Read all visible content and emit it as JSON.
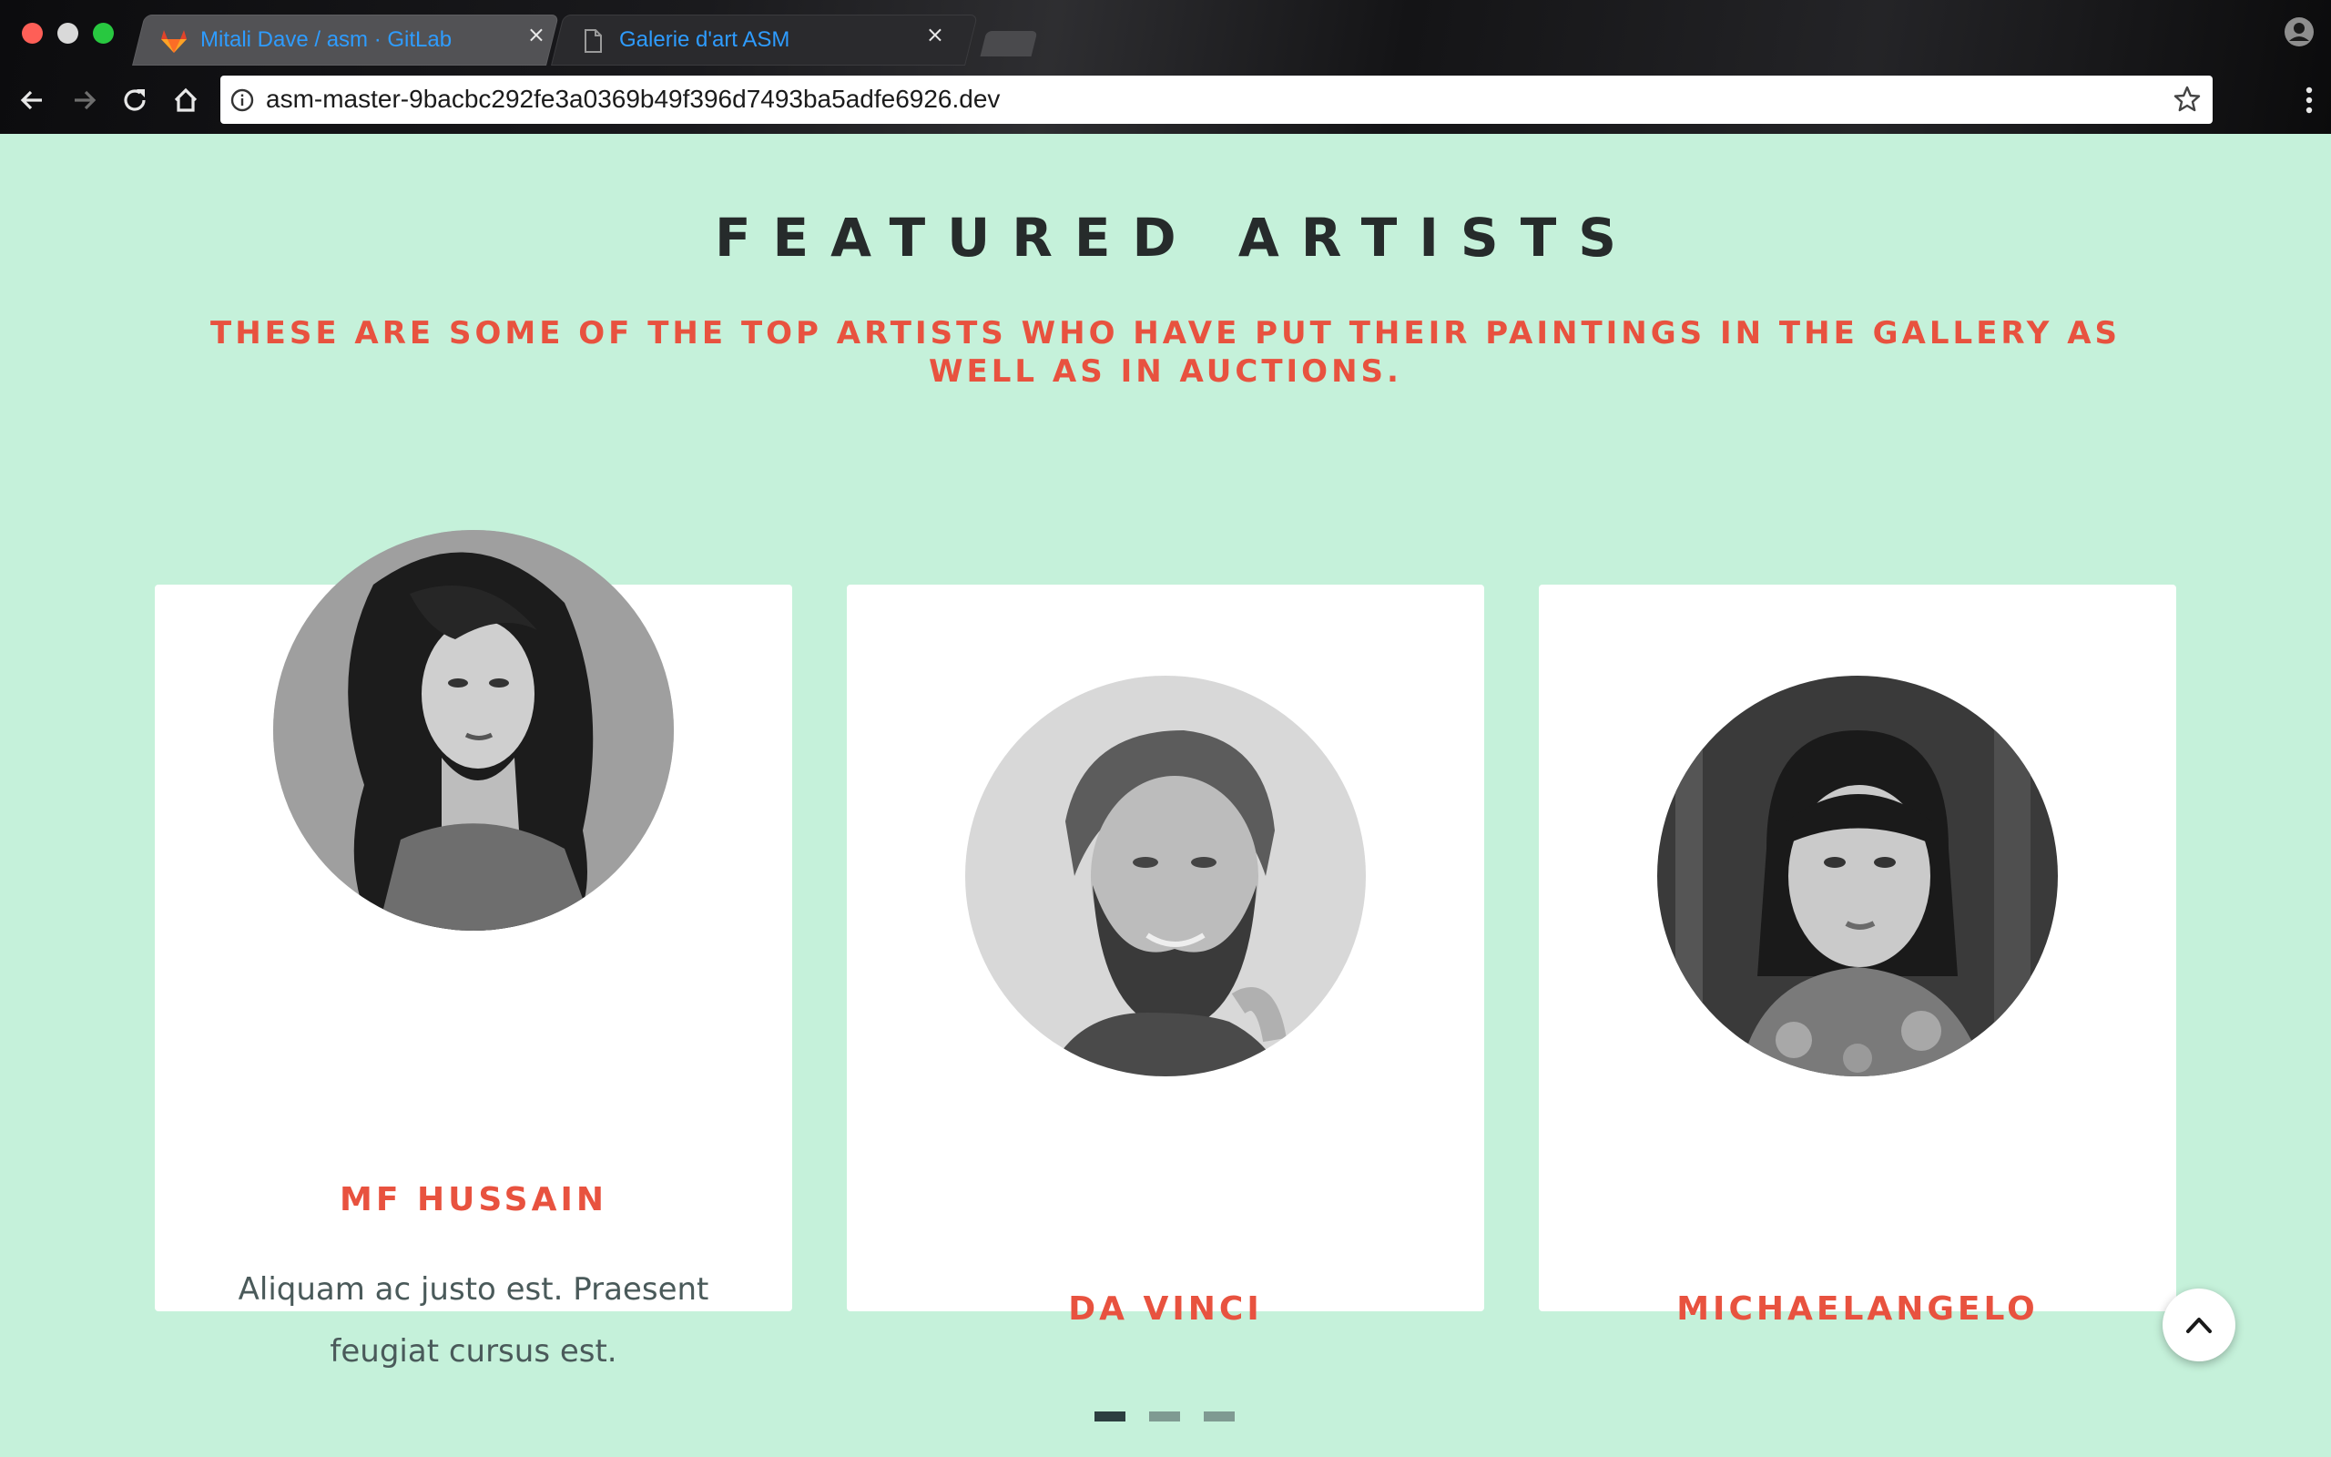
{
  "browser": {
    "tabs": [
      {
        "title": "Mitali Dave / asm · GitLab",
        "favicon": "gitlab-icon",
        "active": true
      },
      {
        "title": "Galerie d'art ASM",
        "favicon": "page-icon",
        "active": false
      }
    ],
    "close_glyph": "×",
    "url": "asm-master-9bacbc292fe3a0369b49f396d7493ba5adfe6926.dev"
  },
  "section": {
    "title": "FEATURED ARTISTS",
    "subtitle": "THESE ARE SOME OF THE TOP ARTISTS WHO HAVE PUT THEIR PAINTINGS IN THE GALLERY AS WELL AS IN AUCTIONS."
  },
  "artists": [
    {
      "name": "MF HUSSAIN",
      "bio": "Aliquam ac justo est. Praesent feugiat cursus est.",
      "photo": "artist-photo-woman-curly-hair"
    },
    {
      "name": "DA VINCI",
      "bio": "",
      "photo": "artist-photo-bearded-man"
    },
    {
      "name": "MICHAELANGELO",
      "bio": "",
      "photo": "artist-photo-woman-bangs"
    }
  ],
  "carousel": {
    "pages": 3,
    "active_index": 0
  },
  "colors": {
    "page_background": "#c5f1da",
    "heading": "#262b2b",
    "accent": "#e8523f",
    "card": "#ffffff",
    "tab_text": "#2e9cff",
    "dot_active": "#2d3e40",
    "dot_inactive": "#7f9a92"
  }
}
